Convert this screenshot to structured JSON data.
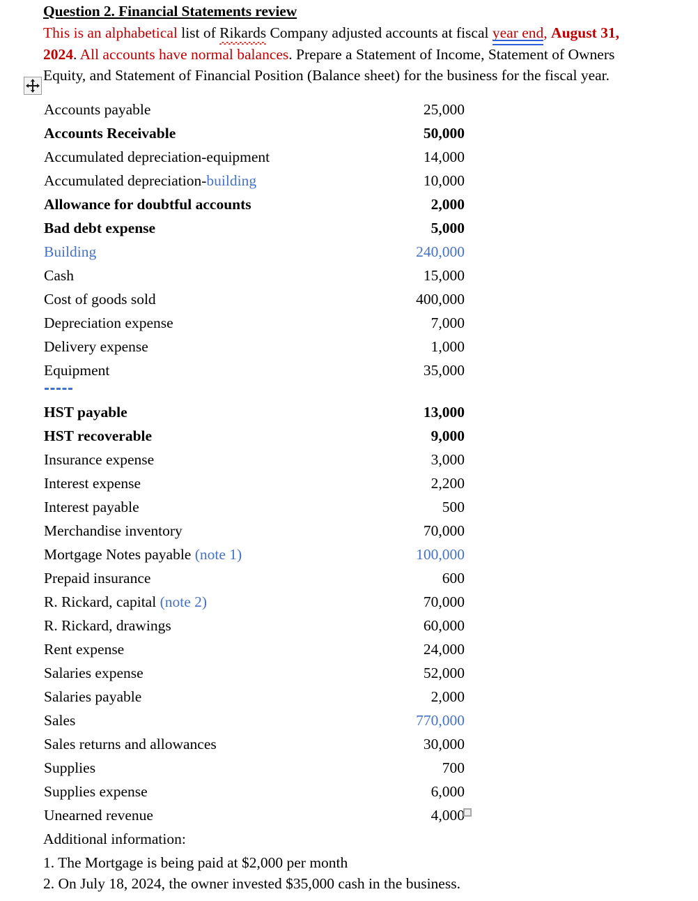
{
  "document": {
    "heading": "Question 2. Financial Statements review",
    "intro": {
      "seg1_red": "This is an alphabetical",
      "seg2": " list of ",
      "seg3_misspelled": "Rikards",
      "seg4": " Company adjusted accounts at fiscal ",
      "seg5_grammar_red": "year end",
      "seg6_red": ", ",
      "seg7_red_bold": "August 31, 2024",
      "seg8": ".",
      "seg9_red": "All accounts have normal balances",
      "seg10": ". Prepare a Statement of Income, Statement of Owners Equity, and Statement of Financial Position (Balance sheet) for the business for the fiscal year."
    },
    "accounts": [
      {
        "name": "Accounts payable",
        "amount": "25,000",
        "bold": false,
        "color": "default"
      },
      {
        "name": "Accounts Receivable",
        "amount": "50,000",
        "bold": true,
        "color": "default"
      },
      {
        "name": "Accumulated depreciation-equipment",
        "amount": "14,000",
        "bold": false,
        "color": "default"
      },
      {
        "name": "Accumulated depreciation-",
        "name_blue": "building",
        "amount": "10,000",
        "bold": false,
        "color": "default"
      },
      {
        "name": "Allowance for doubtful accounts",
        "amount": "2,000",
        "bold": true,
        "color": "default"
      },
      {
        "name": "Bad debt expense",
        "amount": "5,000",
        "bold": true,
        "color": "default"
      },
      {
        "name": "Building",
        "amount": "240,000",
        "bold": false,
        "color": "blue"
      },
      {
        "name": "Cash",
        "amount": "15,000",
        "bold": false,
        "color": "default"
      },
      {
        "name": "Cost of goods sold",
        "amount": "400,000",
        "bold": false,
        "color": "default"
      },
      {
        "name": "Depreciation expense",
        "amount": "7,000",
        "bold": false,
        "color": "default"
      },
      {
        "name": "Delivery expense",
        "amount": "1,000",
        "bold": false,
        "color": "default"
      },
      {
        "name": "Equipment",
        "amount": "35,000",
        "bold": false,
        "color": "default"
      },
      {
        "name": "HST payable",
        "amount": "13,000",
        "bold": true,
        "color": "default"
      },
      {
        "name": "HST recoverable",
        "amount": "9,000",
        "bold": true,
        "color": "default"
      },
      {
        "name": "Insurance expense",
        "amount": "3,000",
        "bold": false,
        "color": "default"
      },
      {
        "name": "Interest expense",
        "amount": "2,200",
        "bold": false,
        "color": "default"
      },
      {
        "name": "Interest payable",
        "amount": "500",
        "bold": false,
        "color": "default"
      },
      {
        "name": "Merchandise inventory",
        "amount": "70,000",
        "bold": false,
        "color": "default"
      },
      {
        "name": "Mortgage Notes payable ",
        "name_blue": "(note 1)",
        "amount": "100,000",
        "bold": false,
        "color": "amount-blue"
      },
      {
        "name": "Prepaid insurance",
        "amount": "600",
        "bold": false,
        "color": "default"
      },
      {
        "name": "R. Rickard, capital ",
        "name_blue": "(note 2)",
        "amount": "70,000",
        "bold": false,
        "color": "default"
      },
      {
        "name": "R. Rickard, drawings",
        "amount": "60,000",
        "bold": false,
        "color": "default"
      },
      {
        "name": "Rent expense",
        "amount": "24,000",
        "bold": false,
        "color": "default"
      },
      {
        "name": "Salaries expense",
        "amount": "52,000",
        "bold": false,
        "color": "default"
      },
      {
        "name": "Salaries payable",
        "amount": "2,000",
        "bold": false,
        "color": "default"
      },
      {
        "name": "Sales",
        "amount": "770,000",
        "bold": false,
        "color": "amount-blue"
      },
      {
        "name": "Sales returns and allowances",
        "amount": "30,000",
        "bold": false,
        "color": "default"
      },
      {
        "name": "Supplies",
        "amount": "700",
        "bold": false,
        "color": "default"
      },
      {
        "name": "Supplies expense",
        "amount": "6,000",
        "bold": false,
        "color": "default"
      },
      {
        "name": "Unearned revenue",
        "amount": "4,000",
        "bold": false,
        "color": "default"
      }
    ],
    "additional": {
      "title": "Additional information:",
      "note1": "1. The Mortgage is being paid at $2,000 per month",
      "note2": "2. On July 18, 2024, the owner invested $35,000 cash in the business."
    },
    "colors": {
      "red": "#C00000",
      "blue": "#4472C4",
      "spellcheck_red": "#D93025",
      "grammar_blue": "#2B5FD9"
    }
  }
}
